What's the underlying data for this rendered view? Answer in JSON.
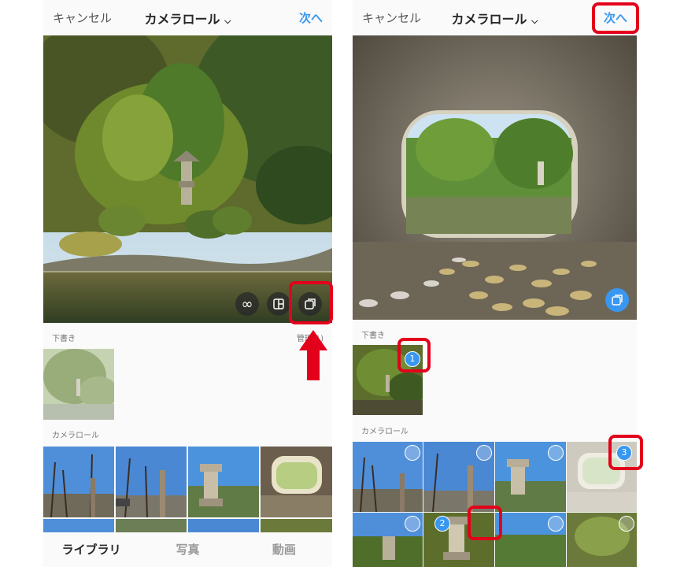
{
  "left": {
    "cancel": "キャンセル",
    "title": "カメラロール",
    "next": "次へ",
    "draft_label": "下書き",
    "manage_label": "管理(1)",
    "roll_label": "カメラロール",
    "tabs": [
      "ライブラリ",
      "写真",
      "動画"
    ]
  },
  "right": {
    "cancel": "キャンセル",
    "title": "カメラロール",
    "next": "次へ",
    "draft_label": "下書き",
    "roll_label": "カメラロール",
    "selections": [
      "1",
      "2",
      "3"
    ]
  },
  "colors": {
    "accent": "#3897f0",
    "highlight": "#e3001b"
  },
  "icons": [
    "infinity-icon",
    "layout-icon",
    "multi-select-icon",
    "chevron-down-icon"
  ]
}
